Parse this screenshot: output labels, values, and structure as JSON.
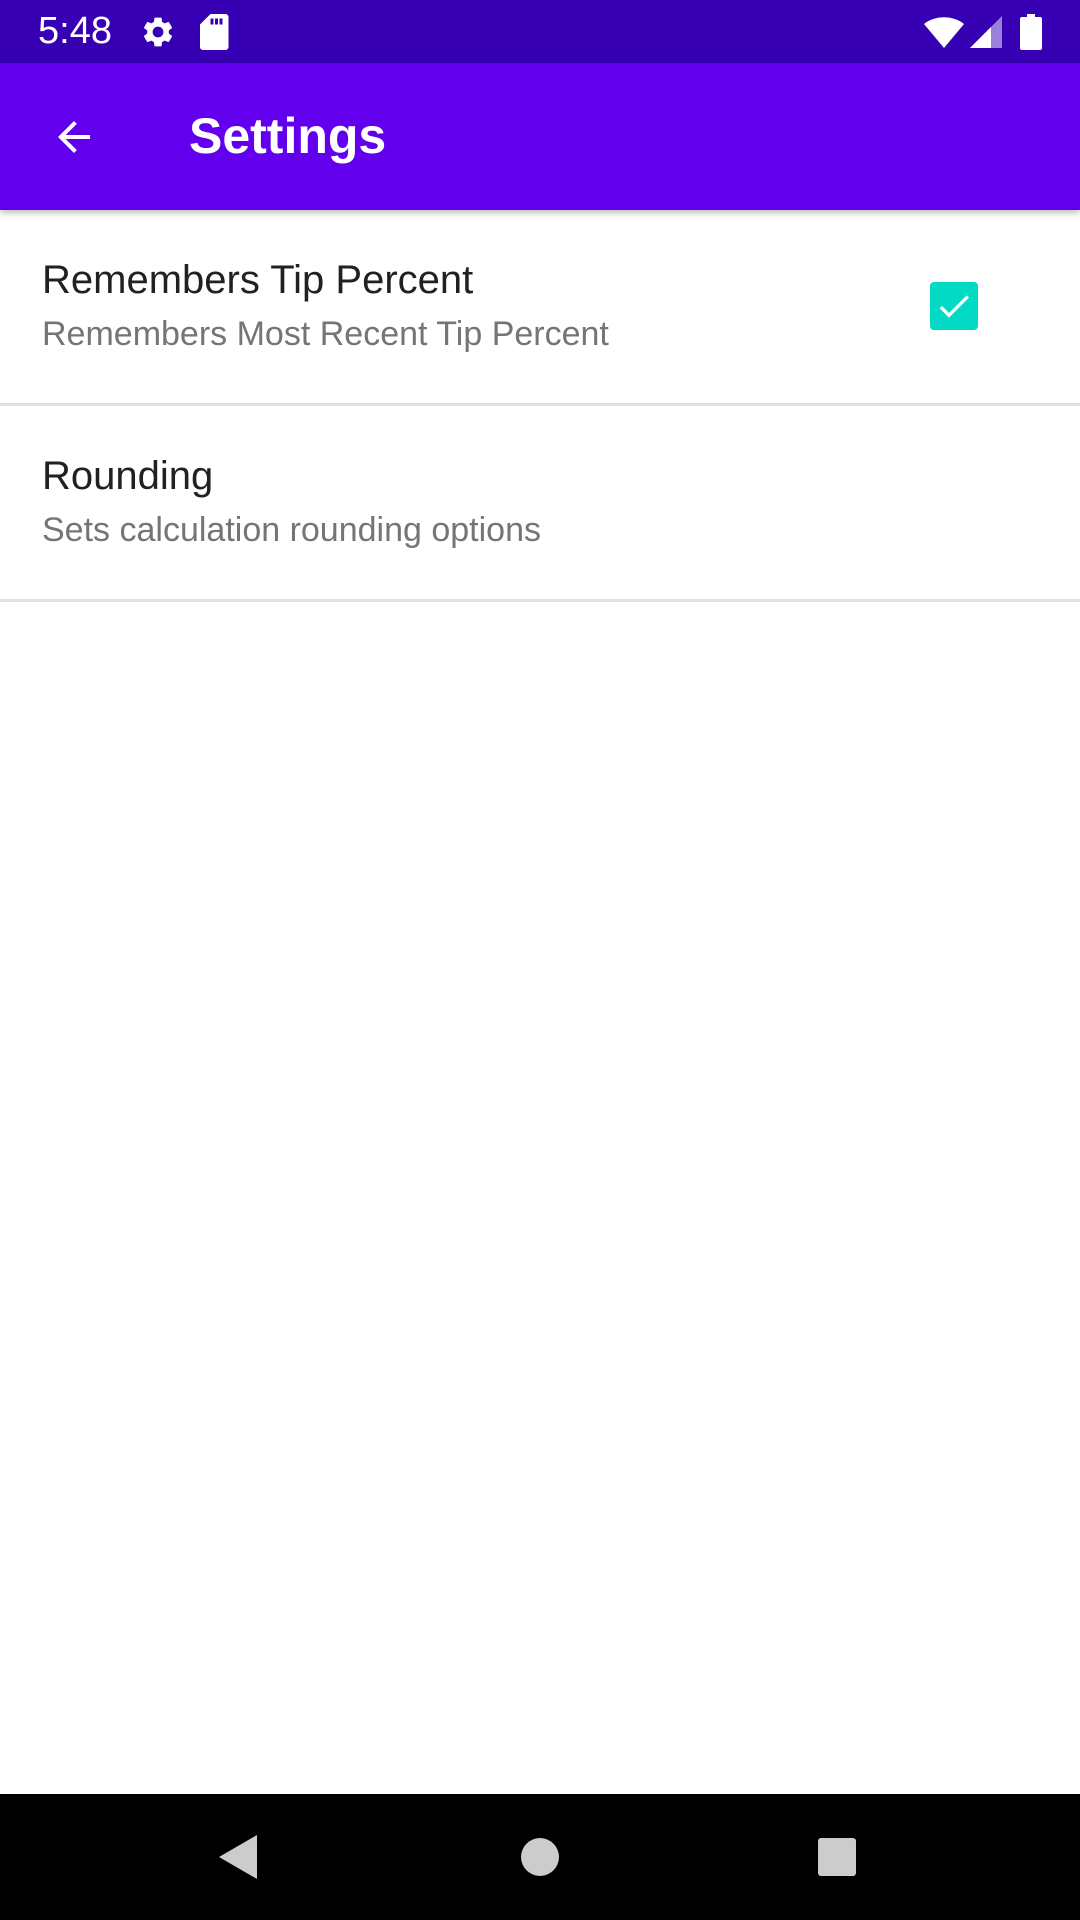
{
  "status_bar": {
    "time": "5:48",
    "icons": [
      "settings-icon",
      "sd-card-icon",
      "wifi-icon",
      "signal-icon",
      "battery-icon"
    ],
    "background": "#3700b3"
  },
  "app_bar": {
    "title": "Settings",
    "back_icon": "arrow-back-icon",
    "background": "#6200ee"
  },
  "preferences": [
    {
      "title": "Remembers Tip Percent",
      "summary": "Remembers Most Recent Tip Percent",
      "checkbox": true
    },
    {
      "title": "Rounding",
      "summary": "Sets calculation rounding options"
    }
  ],
  "colors": {
    "accent": "#03dac5",
    "primary": "#6200ee",
    "primary_dark": "#3700b3"
  },
  "nav_bar": {
    "buttons": [
      "back-triangle-icon",
      "home-circle-icon",
      "recents-square-icon"
    ]
  }
}
